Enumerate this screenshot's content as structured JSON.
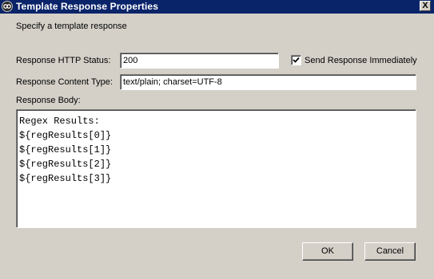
{
  "window": {
    "title": "Template Response Properties",
    "close_label": "X"
  },
  "instruction": "Specify a template response",
  "fields": {
    "status_label": "Response HTTP Status:",
    "status_value": "200",
    "send_immediately_label": "Send Response Immediately",
    "send_immediately_checked": true,
    "content_type_label": "Response Content Type:",
    "content_type_value": "text/plain; charset=UTF-8",
    "body_label": "Response Body:",
    "body_lines": [
      "Regex Results:",
      "${regResults[0]}",
      "${regResults[1]}",
      "${regResults[2]}",
      "${regResults[3]}"
    ]
  },
  "buttons": {
    "ok_label": "OK",
    "cancel_label": "Cancel"
  },
  "icons": {
    "title": "app-logo-icon",
    "close": "close-icon",
    "check": "checkmark-icon"
  },
  "colors": {
    "titlebar": "#0a246a",
    "window": "#d4d0c8"
  }
}
